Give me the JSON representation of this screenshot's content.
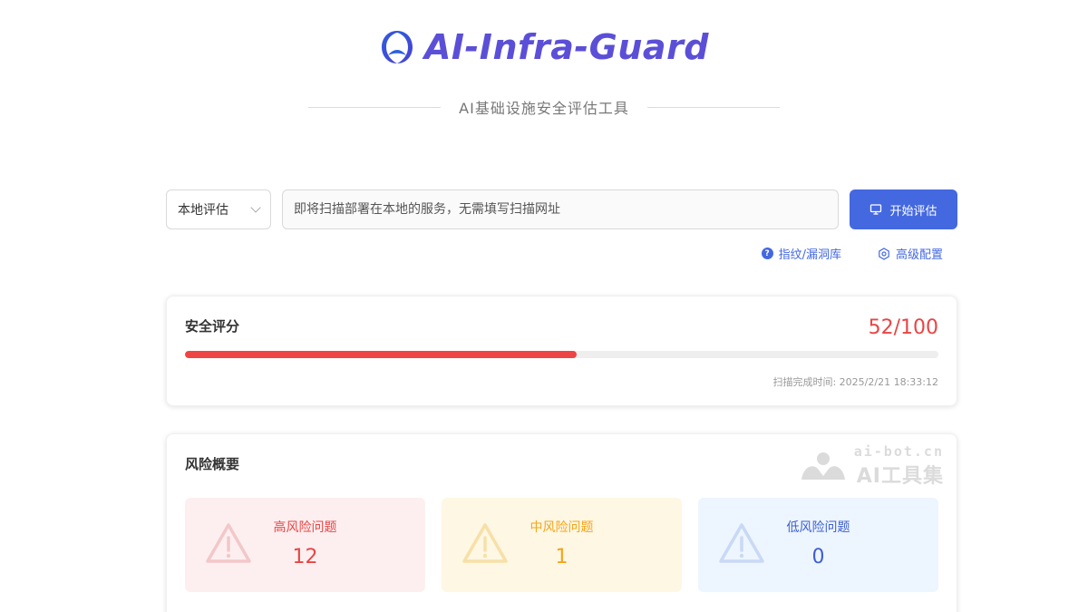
{
  "header": {
    "logo_text": "AI-Infra-Guard",
    "subtitle": "AI基础设施安全评估工具",
    "logo_icon": "shield-orbit-icon",
    "brand_color": "#5b4fd8"
  },
  "search": {
    "mode_value": "本地评估",
    "placeholder": "即将扫描部署在本地的服务，无需填写扫描网址",
    "start_label": "开始评估",
    "accent": "#4468e0"
  },
  "links": {
    "fingerprint_label": "指纹/漏洞库",
    "advanced_label": "高级配置"
  },
  "score": {
    "title": "安全评分",
    "value": "52/100",
    "progress_fraction": 0.52,
    "scan_time": "扫描完成时间: 2025/2/21 18:33:12"
  },
  "risk": {
    "title": "风险概要",
    "tiles": [
      {
        "label": "高风险问题",
        "count": "12",
        "color": "#e84545"
      },
      {
        "label": "中风险问题",
        "count": "1",
        "color": "#f3a51c"
      },
      {
        "label": "低风险问题",
        "count": "0",
        "color": "#3e5fd0"
      }
    ]
  },
  "watermark": {
    "url": "ai-bot.cn",
    "name": "AI工具集"
  }
}
